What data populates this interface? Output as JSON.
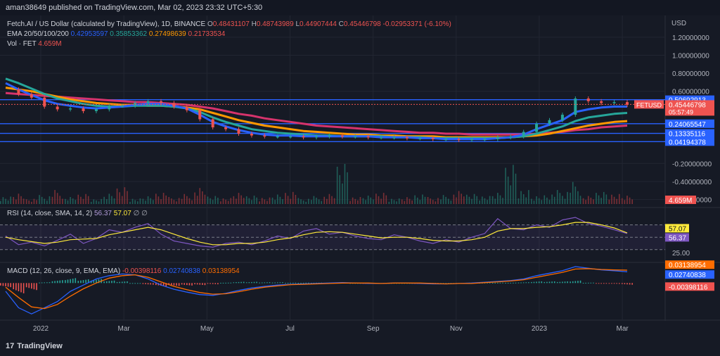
{
  "header": {
    "published": "aman38649 published on TradingView.com, Mar 02, 2023 23:32 UTC+5:30"
  },
  "price_axis_label": "USD",
  "legend": {
    "symbol": "Fetch.AI / US Dollar (calculated by TradingView), 1D, BINANCE",
    "o_label": "O",
    "o": "0.48431107",
    "h_label": "H",
    "h": "0.48743989",
    "l_label": "L",
    "l": "0.44907444",
    "c_label": "C",
    "c": "0.45446798",
    "change": "-0.02953371 (-6.10%)",
    "ema_label": "EMA 20/50/100/200",
    "ema20": "0.42953597",
    "ema50": "0.35853362",
    "ema100": "0.27498639",
    "ema200": "0.21733534",
    "vol_label": "Vol · FET",
    "vol": "4.659M",
    "rsi_label": "RSI (14, close, SMA, 14, 2)",
    "rsi": "56.37",
    "rsi_sma": "57.07",
    "rsi_extra": "∅ ∅",
    "macd_label": "MACD (12, 26, close, 9, EMA, EMA)",
    "macd_hist": "-0.00398116",
    "macd": "0.02740838",
    "macd_signal": "0.03138954"
  },
  "colors": {
    "background": "#161a25",
    "grid": "#222632",
    "hline": "#2962ff",
    "ema20": "#2962ff",
    "ema50": "#26a69a",
    "ema100": "#ff9800",
    "ema200": "#d6336c",
    "up": "#26a69a",
    "down": "#ef5350",
    "rsi": "#7e57c2",
    "rsi_sma": "#ffeb3b",
    "macd": "#2962ff",
    "macd_signal": "#ff6d00"
  },
  "chart_data": [
    {
      "type": "line",
      "pane": "price",
      "y_ticks": [
        "1.20000000",
        "1.00000000",
        "0.80000000",
        "0.60000000",
        "-0.20000000",
        "-0.40000000",
        "-0.60000000"
      ],
      "ylim": [
        -0.65,
        1.3
      ],
      "x_ticks": [
        "2022",
        "Mar",
        "May",
        "Jul",
        "Sep",
        "Nov",
        "2023",
        "Mar"
      ],
      "horizontal_levels": [
        "0.50692913",
        "0.24065547",
        "0.13335116",
        "0.04194378"
      ],
      "price_badge": {
        "symbol": "FETUSD",
        "price": "0.45446798",
        "countdown": "05:57:49"
      },
      "series": [
        {
          "name": "Price",
          "values": [
            0.62,
            0.57,
            0.53,
            0.43,
            0.4,
            0.41,
            0.38,
            0.4,
            0.44,
            0.44,
            0.47,
            0.49,
            0.47,
            0.43,
            0.39,
            0.29,
            0.2,
            0.18,
            0.13,
            0.11,
            0.1,
            0.1,
            0.1,
            0.09,
            0.1,
            0.11,
            0.1,
            0.1,
            0.09,
            0.09,
            0.09,
            0.08,
            0.08,
            0.07,
            0.07,
            0.06,
            0.07,
            0.07,
            0.09,
            0.1,
            0.15,
            0.24,
            0.28,
            0.34,
            0.52,
            0.49,
            0.47,
            0.48,
            0.45
          ]
        },
        {
          "name": "EMA 20",
          "values": [
            0.69,
            0.62,
            0.56,
            0.5,
            0.46,
            0.44,
            0.42,
            0.41,
            0.42,
            0.43,
            0.45,
            0.46,
            0.46,
            0.44,
            0.41,
            0.34,
            0.26,
            0.21,
            0.17,
            0.14,
            0.12,
            0.11,
            0.11,
            0.1,
            0.1,
            0.1,
            0.1,
            0.1,
            0.1,
            0.09,
            0.09,
            0.09,
            0.08,
            0.08,
            0.07,
            0.07,
            0.07,
            0.07,
            0.08,
            0.09,
            0.12,
            0.18,
            0.23,
            0.28,
            0.37,
            0.4,
            0.42,
            0.43,
            0.43
          ]
        },
        {
          "name": "EMA 50",
          "values": [
            0.74,
            0.69,
            0.63,
            0.57,
            0.52,
            0.49,
            0.46,
            0.44,
            0.43,
            0.43,
            0.44,
            0.44,
            0.44,
            0.43,
            0.41,
            0.37,
            0.31,
            0.26,
            0.22,
            0.18,
            0.16,
            0.14,
            0.13,
            0.12,
            0.11,
            0.11,
            0.1,
            0.1,
            0.1,
            0.1,
            0.09,
            0.09,
            0.09,
            0.08,
            0.08,
            0.08,
            0.08,
            0.08,
            0.08,
            0.09,
            0.1,
            0.13,
            0.17,
            0.21,
            0.27,
            0.31,
            0.33,
            0.35,
            0.36
          ]
        },
        {
          "name": "EMA 100",
          "values": [
            0.64,
            0.62,
            0.6,
            0.57,
            0.54,
            0.51,
            0.49,
            0.47,
            0.46,
            0.45,
            0.45,
            0.44,
            0.44,
            0.43,
            0.42,
            0.4,
            0.36,
            0.32,
            0.28,
            0.25,
            0.22,
            0.2,
            0.18,
            0.16,
            0.15,
            0.14,
            0.13,
            0.12,
            0.12,
            0.11,
            0.11,
            0.1,
            0.1,
            0.1,
            0.09,
            0.09,
            0.09,
            0.09,
            0.09,
            0.09,
            0.1,
            0.11,
            0.13,
            0.16,
            0.19,
            0.22,
            0.24,
            0.26,
            0.27
          ]
        },
        {
          "name": "EMA 200",
          "values": [
            0.58,
            0.57,
            0.56,
            0.55,
            0.54,
            0.53,
            0.52,
            0.51,
            0.5,
            0.49,
            0.48,
            0.48,
            0.47,
            0.46,
            0.45,
            0.43,
            0.41,
            0.38,
            0.35,
            0.33,
            0.3,
            0.28,
            0.26,
            0.24,
            0.22,
            0.21,
            0.2,
            0.19,
            0.18,
            0.17,
            0.16,
            0.15,
            0.14,
            0.14,
            0.13,
            0.13,
            0.12,
            0.12,
            0.12,
            0.12,
            0.12,
            0.13,
            0.14,
            0.15,
            0.17,
            0.18,
            0.2,
            0.21,
            0.22
          ]
        }
      ]
    },
    {
      "type": "bar",
      "pane": "volume",
      "series": [
        {
          "name": "Vol",
          "values": [
            8,
            12,
            6,
            9,
            14,
            7,
            10,
            5,
            11,
            18,
            6,
            9,
            13,
            7,
            10,
            16,
            8,
            6,
            12,
            9,
            7,
            11,
            14,
            6,
            8,
            10,
            40,
            7,
            9,
            12,
            6,
            8,
            11,
            7,
            9,
            13,
            10,
            8,
            12,
            42,
            15,
            9,
            11,
            14,
            22,
            8,
            12,
            10,
            9
          ]
        }
      ],
      "directions": [
        1,
        -1,
        -1,
        1,
        -1,
        1,
        -1,
        1,
        1,
        -1,
        1,
        1,
        -1,
        -1,
        -1,
        -1,
        1,
        -1,
        -1,
        1,
        -1,
        1,
        -1,
        1,
        1,
        -1,
        1,
        -1,
        1,
        -1,
        1,
        -1,
        1,
        -1,
        1,
        -1,
        1,
        1,
        1,
        1,
        1,
        1,
        1,
        1,
        1,
        -1,
        1,
        -1,
        -1
      ],
      "last_label": "4.659M"
    },
    {
      "type": "line",
      "pane": "rsi",
      "y_ticks": [
        "25.00"
      ],
      "ylim": [
        15,
        90
      ],
      "levels": [
        70,
        50,
        30
      ],
      "series": [
        {
          "name": "RSI",
          "values": [
            52,
            38,
            42,
            36,
            45,
            55,
            40,
            48,
            62,
            58,
            66,
            72,
            55,
            44,
            40,
            36,
            34,
            40,
            42,
            38,
            44,
            52,
            48,
            60,
            64,
            55,
            58,
            52,
            48,
            46,
            54,
            50,
            44,
            40,
            46,
            42,
            50,
            56,
            80,
            64,
            62,
            70,
            66,
            78,
            82,
            72,
            68,
            62,
            56
          ]
        },
        {
          "name": "RSI SMA",
          "values": [
            50,
            46,
            43,
            40,
            42,
            46,
            47,
            48,
            54,
            58,
            62,
            66,
            62,
            55,
            48,
            42,
            38,
            38,
            40,
            40,
            42,
            46,
            49,
            54,
            58,
            59,
            58,
            55,
            52,
            49,
            50,
            50,
            48,
            45,
            44,
            44,
            46,
            50,
            60,
            64,
            64,
            66,
            67,
            70,
            74,
            74,
            70,
            65,
            57
          ]
        }
      ],
      "badges": [
        "57.07",
        "56.37"
      ]
    },
    {
      "type": "line",
      "pane": "macd",
      "ylim": [
        -0.085,
        0.045
      ],
      "series": [
        {
          "name": "MACD",
          "values": [
            -0.02,
            -0.06,
            -0.075,
            -0.06,
            -0.045,
            -0.02,
            -0.005,
            0.01,
            0.018,
            0.022,
            0.02,
            0.01,
            -0.005,
            -0.015,
            -0.022,
            -0.028,
            -0.03,
            -0.025,
            -0.018,
            -0.012,
            -0.008,
            -0.005,
            -0.003,
            -0.002,
            -0.001,
            0.0,
            0.001,
            0.0,
            -0.001,
            -0.001,
            0.0,
            0.0,
            -0.001,
            -0.002,
            -0.002,
            -0.001,
            0.0,
            0.002,
            0.004,
            0.006,
            0.01,
            0.018,
            0.024,
            0.03,
            0.04,
            0.036,
            0.032,
            0.03,
            0.0274
          ]
        },
        {
          "name": "Signal",
          "values": [
            -0.01,
            -0.035,
            -0.058,
            -0.062,
            -0.052,
            -0.032,
            -0.014,
            0.0,
            0.012,
            0.018,
            0.02,
            0.014,
            0.003,
            -0.008,
            -0.016,
            -0.023,
            -0.027,
            -0.026,
            -0.021,
            -0.015,
            -0.01,
            -0.007,
            -0.004,
            -0.003,
            -0.002,
            -0.001,
            0.0,
            0.0,
            0.0,
            -0.001,
            0.0,
            0.0,
            0.0,
            -0.001,
            -0.002,
            -0.001,
            -0.001,
            0.001,
            0.003,
            0.005,
            0.008,
            0.014,
            0.02,
            0.026,
            0.034,
            0.035,
            0.033,
            0.032,
            0.0314
          ]
        }
      ],
      "histogram": [
        -0.01,
        -0.025,
        -0.017,
        0.002,
        0.007,
        0.012,
        0.009,
        0.01,
        0.006,
        0.004,
        0.0,
        -0.004,
        -0.008,
        -0.007,
        -0.006,
        -0.005,
        -0.003,
        0.001,
        0.003,
        0.003,
        0.002,
        0.002,
        0.001,
        0.001,
        0.001,
        0.001,
        0.001,
        0.0,
        -0.001,
        0.0,
        0.0,
        0.0,
        -0.001,
        -0.001,
        0.0,
        0.0,
        0.001,
        0.001,
        0.001,
        0.001,
        0.002,
        0.004,
        0.004,
        0.004,
        0.006,
        0.001,
        -0.001,
        -0.002,
        -0.004
      ],
      "badges": [
        "0.03138954",
        "0.02740838",
        "-0.00398116"
      ]
    }
  ],
  "footer": {
    "logo_mark": "17",
    "brand": "TradingView"
  }
}
